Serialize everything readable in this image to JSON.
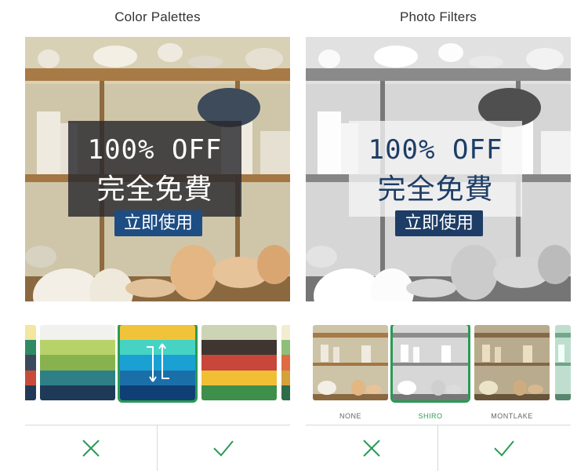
{
  "left_panel": {
    "title": "Color Palettes",
    "promo": {
      "line1": "100% OFF",
      "line2": "完全免費",
      "cta": "立即使用"
    },
    "palettes": [
      {
        "id": "palette-partial-left",
        "colors": [
          "#f2e6a0",
          "#2f8a63",
          "#3a4a5c",
          "#c84b3a",
          "#223a57"
        ]
      },
      {
        "id": "palette-green-navy",
        "colors": [
          "#f1f1ef",
          "#b8d26a",
          "#88b24e",
          "#2e7f86",
          "#1f3a59"
        ]
      },
      {
        "id": "palette-blue-yellow",
        "colors": [
          "#f1c33a",
          "#46d3c4",
          "#1aa0d3",
          "#1b6fa8",
          "#0f3f74"
        ]
      },
      {
        "id": "palette-earth",
        "colors": [
          "#cdd4b5",
          "#3f3631",
          "#c8463a",
          "#f1bf34",
          "#3d8f4a"
        ]
      },
      {
        "id": "palette-partial-right",
        "colors": [
          "#f3ecd0",
          "#8dbf7a",
          "#e06a44",
          "#d4a13a",
          "#2e6b48"
        ]
      }
    ],
    "selected_index": 2,
    "actions": {
      "cancel": "cancel",
      "confirm": "confirm"
    }
  },
  "right_panel": {
    "title": "Photo Filters",
    "promo": {
      "line1": "100% OFF",
      "line2": "完全免費",
      "cta": "立即使用"
    },
    "filters": [
      {
        "label": "NONE"
      },
      {
        "label": "SHIRO"
      },
      {
        "label": "MONTLAKE"
      }
    ],
    "selected_index": 1,
    "actions": {
      "cancel": "cancel",
      "confirm": "confirm"
    }
  },
  "colors": {
    "accent_green": "#2a9a54",
    "promo_blue": "#1e4d84"
  },
  "icons": {
    "cancel": "x-icon",
    "confirm": "check-icon"
  }
}
